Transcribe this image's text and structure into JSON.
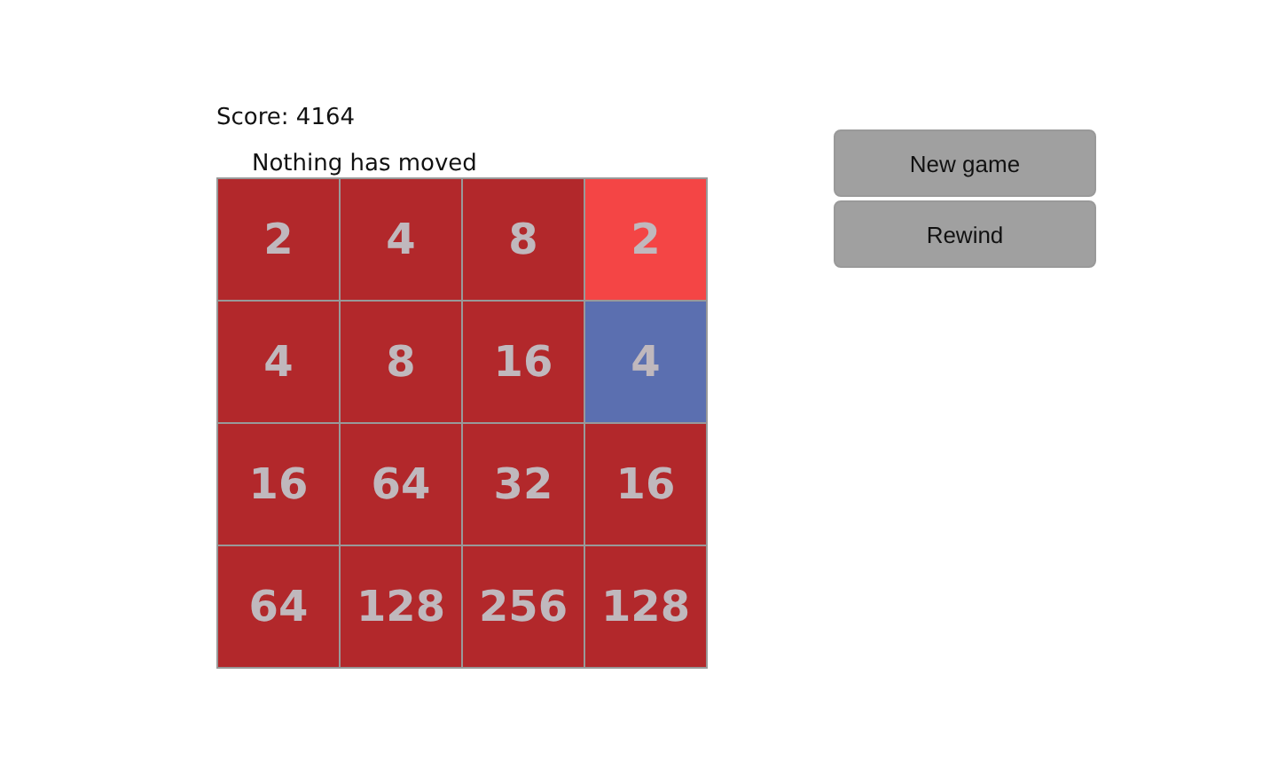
{
  "score": "Score: 4164",
  "message": "Nothing has moved",
  "tiles": [
    {
      "value": "2",
      "color": "#b2282b"
    },
    {
      "value": "4",
      "color": "#b2282b"
    },
    {
      "value": "8",
      "color": "#b2282b"
    },
    {
      "value": "2",
      "color": "#f44545"
    },
    {
      "value": "4",
      "color": "#b2282b"
    },
    {
      "value": "8",
      "color": "#b2282b"
    },
    {
      "value": "16",
      "color": "#b2282b"
    },
    {
      "value": "4",
      "color": "#5b6fb0"
    },
    {
      "value": "16",
      "color": "#b2282b"
    },
    {
      "value": "64",
      "color": "#b2282b"
    },
    {
      "value": "32",
      "color": "#b2282b"
    },
    {
      "value": "16",
      "color": "#b2282b"
    },
    {
      "value": "64",
      "color": "#b2282b"
    },
    {
      "value": "128",
      "color": "#b2282b"
    },
    {
      "value": "256",
      "color": "#b2282b"
    },
    {
      "value": "128",
      "color": "#b2282b"
    }
  ],
  "buttons": [
    "New game",
    "Rewind"
  ]
}
